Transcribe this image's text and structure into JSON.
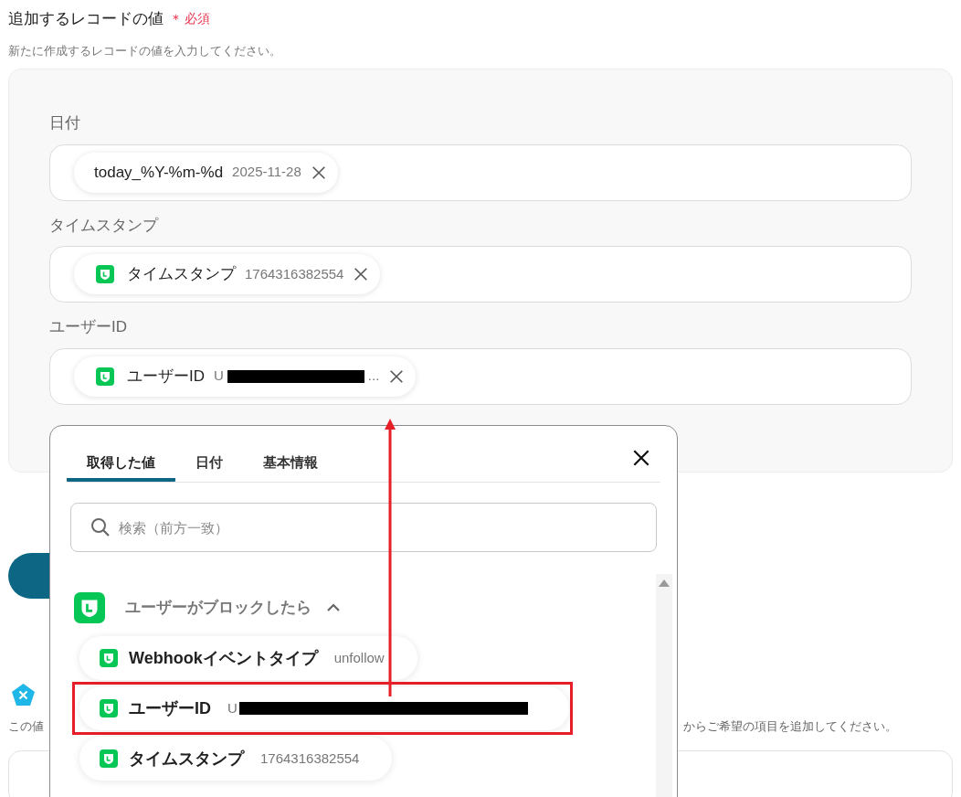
{
  "section": {
    "title": "追加するレコードの値",
    "required_mark": "＊",
    "required_label": "必須",
    "description": "新たに作成するレコードの値を入力してください。"
  },
  "fields": [
    {
      "label": "日付",
      "chip": {
        "kind": "text",
        "name": "today_%Y-%m-%d",
        "value": "2025-11-28",
        "redacted": false
      }
    },
    {
      "label": "タイムスタンプ",
      "chip": {
        "kind": "app",
        "name": "タイムスタンプ",
        "value": "1764316382554",
        "redacted": false
      }
    },
    {
      "label": "ユーザーID",
      "chip": {
        "kind": "app",
        "name": "ユーザーID",
        "value": "U",
        "redacted": true,
        "ellipsis": "..."
      }
    }
  ],
  "below": {
    "text_left": "この値",
    "text_right": "からご希望の項目を追加してください。"
  },
  "picker": {
    "tabs": [
      {
        "label": "取得した値",
        "selected": true
      },
      {
        "label": "日付",
        "selected": false
      },
      {
        "label": "基本情報",
        "selected": false
      }
    ],
    "search": {
      "placeholder": "検索（前方一致）"
    },
    "group": {
      "title": "ユーザーがブロックしたら",
      "expanded": true
    },
    "items": [
      {
        "name": "Webhookイベントタイプ",
        "value": "unfollow",
        "redacted": false,
        "highlighted": false
      },
      {
        "name": "ユーザーID",
        "value": "U",
        "redacted": true,
        "highlighted": true
      },
      {
        "name": "タイムスタンプ",
        "value": "1764316382554",
        "redacted": false,
        "highlighted": false
      }
    ]
  }
}
